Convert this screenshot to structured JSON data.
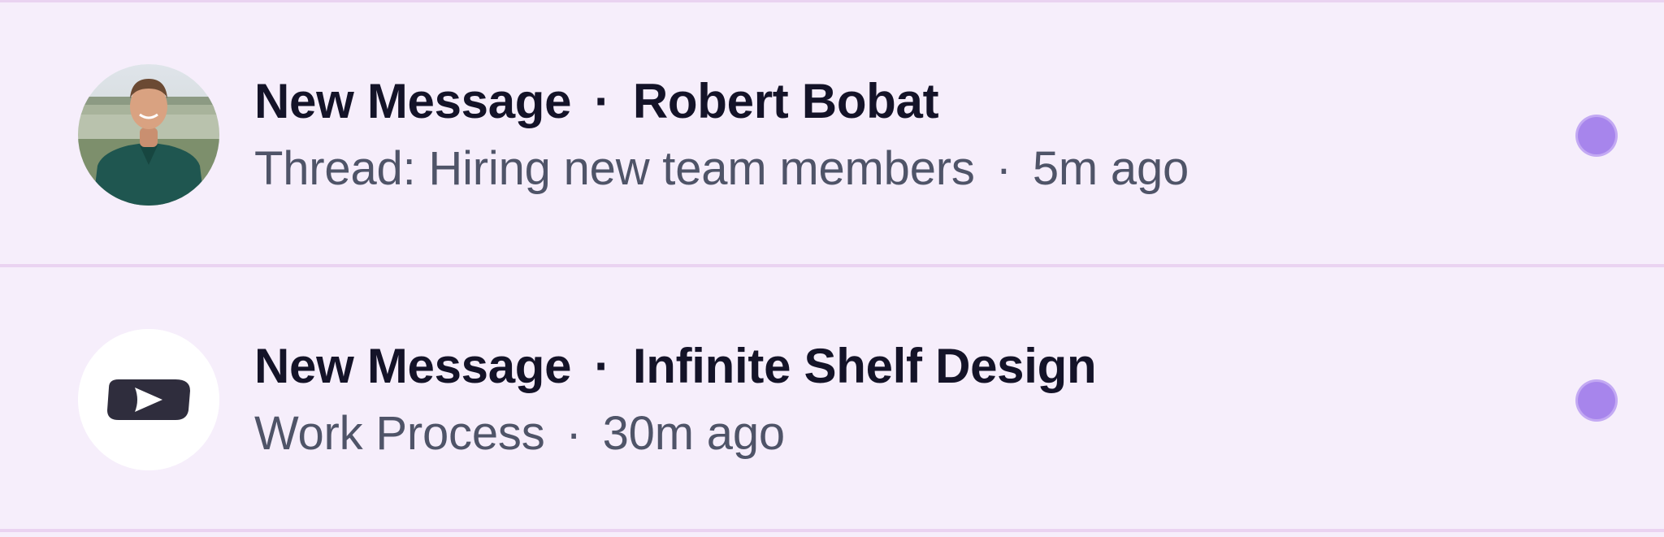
{
  "notifications": [
    {
      "type": "New Message",
      "separator": "·",
      "sender": "Robert Bobat",
      "context": "Thread: Hiring new team members",
      "time": "5m ago",
      "avatar_icon": "person-photo-avatar",
      "unread": true,
      "unread_color": "#a785ec"
    },
    {
      "type": "New Message",
      "separator": "·",
      "sender": "Infinite Shelf Design",
      "context": "Work Process",
      "time": "30m ago",
      "avatar_icon": "infinite-shelf-logo-icon",
      "unread": true,
      "unread_color": "#a785ec"
    }
  ],
  "colors": {
    "background": "#f6eefb",
    "divider": "#ead3f1",
    "title": "#141328",
    "subtitle": "#4f5468"
  }
}
